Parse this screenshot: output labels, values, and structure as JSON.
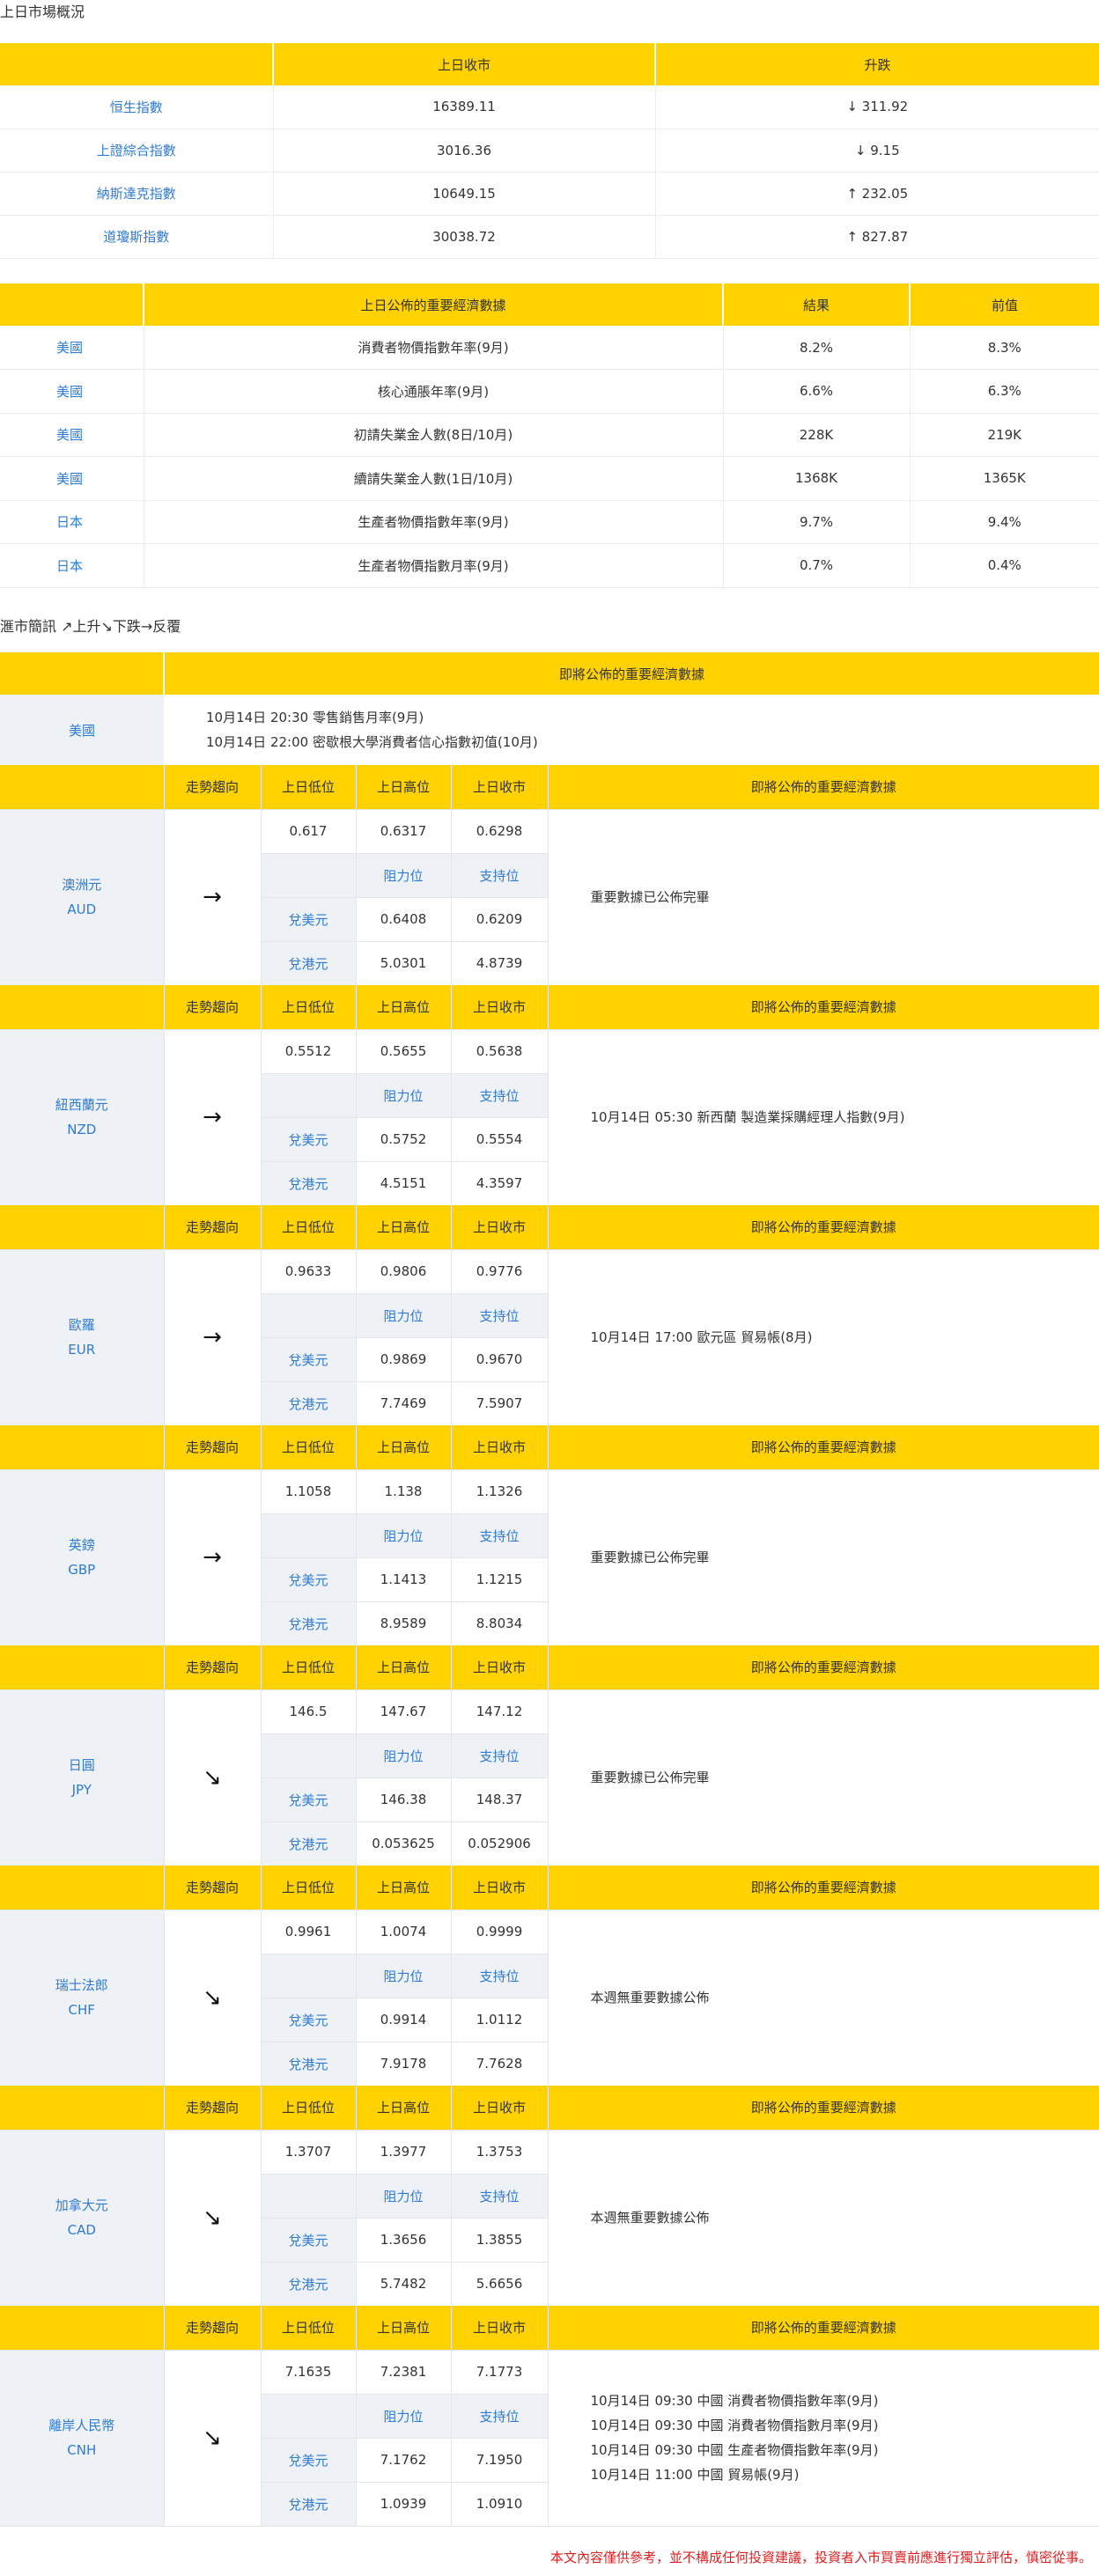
{
  "market": {
    "title": "上日市場概況",
    "headers": [
      "",
      "上日收市",
      "升跌"
    ],
    "rows": [
      {
        "name": "恒生指數",
        "close": "16389.11",
        "change": "↓ 311.92"
      },
      {
        "name": "上證綜合指數",
        "close": "3016.36",
        "change": "↓ 9.15"
      },
      {
        "name": "納斯達克指數",
        "close": "10649.15",
        "change": "↑ 232.05"
      },
      {
        "name": "道瓊斯指數",
        "close": "30038.72",
        "change": "↑ 827.87"
      }
    ]
  },
  "econ": {
    "headers": [
      "",
      "上日公佈的重要經濟數據",
      "結果",
      "前值"
    ],
    "rows": [
      {
        "country": "美國",
        "item": "消費者物價指數年率(9月)",
        "result": "8.2%",
        "prev": "8.3%"
      },
      {
        "country": "美國",
        "item": "核心通脹年率(9月)",
        "result": "6.6%",
        "prev": "6.3%"
      },
      {
        "country": "美國",
        "item": "初請失業金人數(8日/10月)",
        "result": "228K",
        "prev": "219K"
      },
      {
        "country": "美國",
        "item": "續請失業金人數(1日/10月)",
        "result": "1368K",
        "prev": "1365K"
      },
      {
        "country": "日本",
        "item": "生產者物價指數年率(9月)",
        "result": "9.7%",
        "prev": "9.4%"
      },
      {
        "country": "日本",
        "item": "生產者物價指數月率(9月)",
        "result": "0.7%",
        "prev": "0.4%"
      }
    ]
  },
  "legend": "滙市簡訊 ↗上升↘下跌→反覆",
  "upcoming": {
    "header": "即將公佈的重要經濟數據",
    "country": "美國",
    "events": [
      "10月14日 20:30 零售銷售月率(9月)",
      "10月14日 22:00 密歇根大學消費者信心指數初值(10月)"
    ]
  },
  "col_headers": {
    "trend": "走勢趨向",
    "low": "上日低位",
    "high": "上日高位",
    "close": "上日收市",
    "events": "即將公佈的重要經濟數據",
    "resistance": "阻力位",
    "support": "支持位",
    "vs_usd": "兌美元",
    "vs_hkd": "兌港元"
  },
  "currencies": [
    {
      "name": "澳洲元",
      "code": "AUD",
      "trend": "→",
      "low": "0.617",
      "high": "0.6317",
      "close": "0.6298",
      "usd_res": "0.6408",
      "usd_sup": "0.6209",
      "hkd_res": "5.0301",
      "hkd_sup": "4.8739",
      "events": [
        "重要數據已公佈完畢"
      ]
    },
    {
      "name": "紐西蘭元",
      "code": "NZD",
      "trend": "→",
      "low": "0.5512",
      "high": "0.5655",
      "close": "0.5638",
      "usd_res": "0.5752",
      "usd_sup": "0.5554",
      "hkd_res": "4.5151",
      "hkd_sup": "4.3597",
      "events": [
        "10月14日 05:30 新西蘭 製造業採購經理人指數(9月)"
      ]
    },
    {
      "name": "歐羅",
      "code": "EUR",
      "trend": "→",
      "low": "0.9633",
      "high": "0.9806",
      "close": "0.9776",
      "usd_res": "0.9869",
      "usd_sup": "0.9670",
      "hkd_res": "7.7469",
      "hkd_sup": "7.5907",
      "events": [
        "10月14日 17:00 歐元區 貿易帳(8月)"
      ]
    },
    {
      "name": "英鎊",
      "code": "GBP",
      "trend": "→",
      "low": "1.1058",
      "high": "1.138",
      "close": "1.1326",
      "usd_res": "1.1413",
      "usd_sup": "1.1215",
      "hkd_res": "8.9589",
      "hkd_sup": "8.8034",
      "events": [
        "重要數據已公佈完畢"
      ]
    },
    {
      "name": "日圓",
      "code": "JPY",
      "trend": "↘",
      "low": "146.5",
      "high": "147.67",
      "close": "147.12",
      "usd_res": "146.38",
      "usd_sup": "148.37",
      "hkd_res": "0.053625",
      "hkd_sup": "0.052906",
      "events": [
        "重要數據已公佈完畢"
      ]
    },
    {
      "name": "瑞士法郎",
      "code": "CHF",
      "trend": "↘",
      "low": "0.9961",
      "high": "1.0074",
      "close": "0.9999",
      "usd_res": "0.9914",
      "usd_sup": "1.0112",
      "hkd_res": "7.9178",
      "hkd_sup": "7.7628",
      "events": [
        "本週無重要數據公佈"
      ]
    },
    {
      "name": "加拿大元",
      "code": "CAD",
      "trend": "↘",
      "low": "1.3707",
      "high": "1.3977",
      "close": "1.3753",
      "usd_res": "1.3656",
      "usd_sup": "1.3855",
      "hkd_res": "5.7482",
      "hkd_sup": "5.6656",
      "events": [
        "本週無重要數據公佈"
      ]
    },
    {
      "name": "離岸人民幣",
      "code": "CNH",
      "trend": "↘",
      "low": "7.1635",
      "high": "7.2381",
      "close": "7.1773",
      "usd_res": "7.1762",
      "usd_sup": "7.1950",
      "hkd_res": "1.0939",
      "hkd_sup": "1.0910",
      "events": [
        "10月14日 09:30 中國 消費者物價指數年率(9月)",
        "10月14日 09:30 中國 消費者物價指數月率(9月)",
        "10月14日 09:30 中國 生產者物價指數年率(9月)",
        "10月14日 11:00 中國 貿易帳(9月)"
      ]
    }
  ],
  "disclaimer": "本文內容僅供參考，並不構成任何投資建議，投資者入市買賣前應進行獨立評估，慎密從事。"
}
